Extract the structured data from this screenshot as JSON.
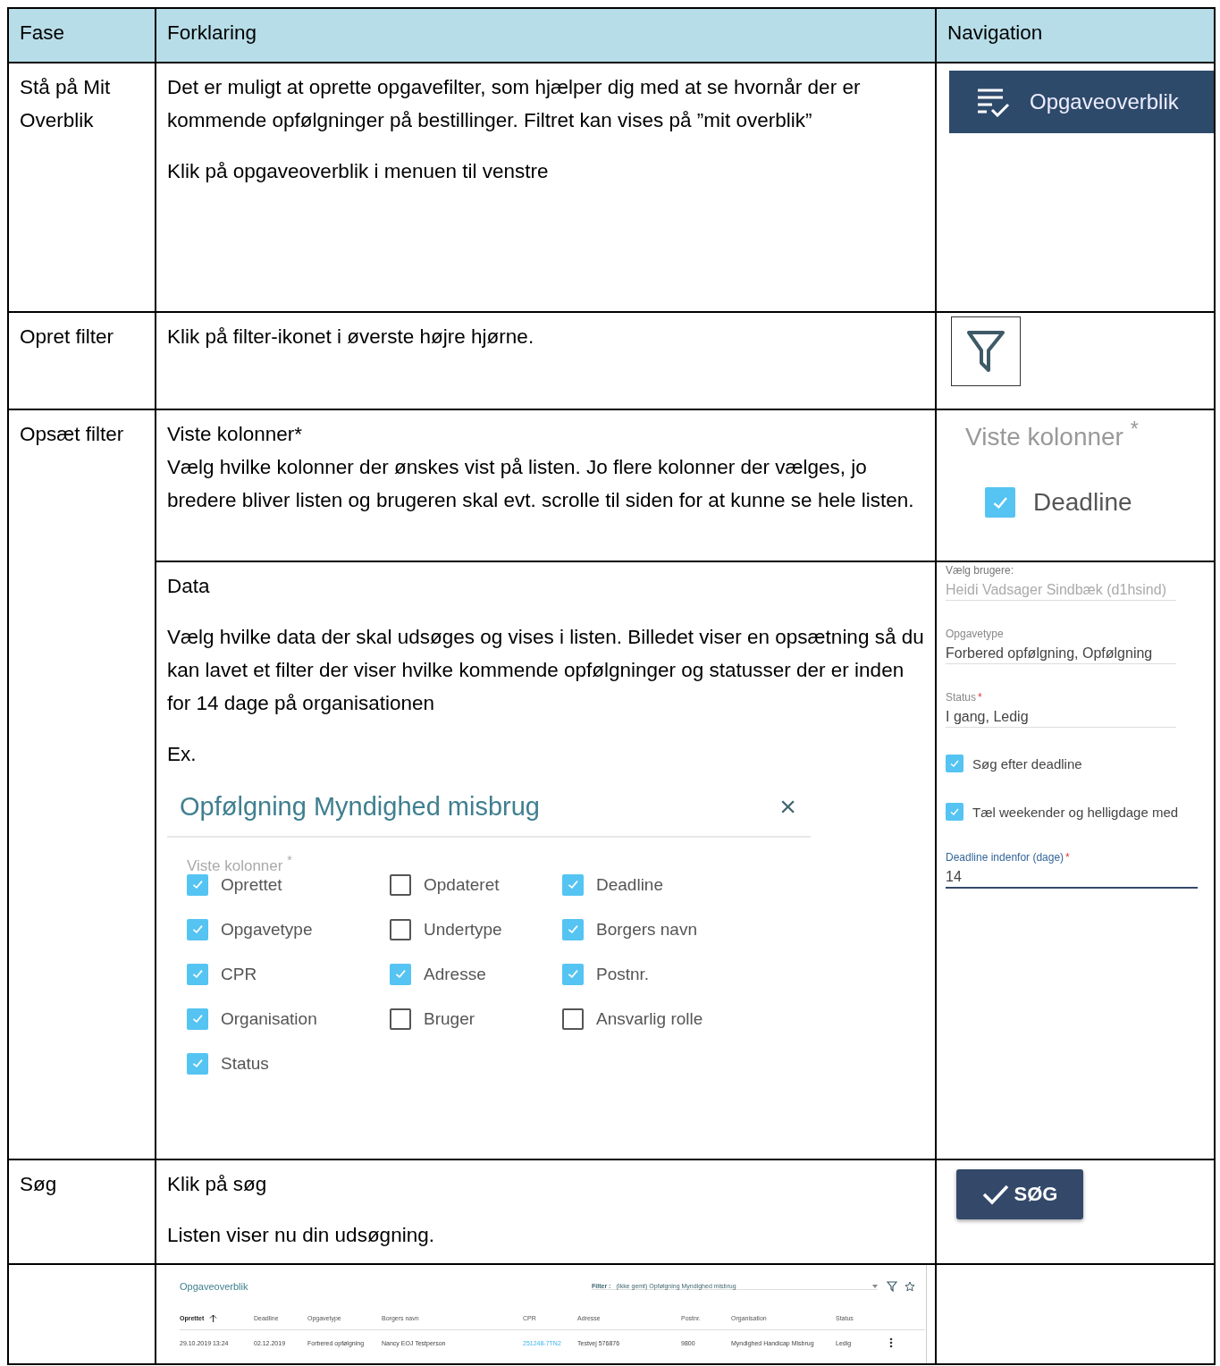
{
  "columns": [
    "Fase",
    "Forklaring",
    "Navigation"
  ],
  "rows": [
    {
      "phase": "Stå på Mit Overblik",
      "steps": [
        {
          "paragraphs": [
            "Det er muligt at oprette opgavefilter, som hjælper dig med at se hvornår der er kommende opfølgninger på bestillinger. Filtret kan vises på ”mit overblik”",
            "Klik på opgaveoverblik i menuen til venstre"
          ],
          "nav": {
            "kind": "menu_item",
            "label": "Opgaveoverblik"
          }
        }
      ]
    },
    {
      "phase": "Opret filter",
      "steps": [
        {
          "paragraphs": [
            "Klik på filter-ikonet i øverste højre hjørne."
          ],
          "nav": {
            "kind": "filter_icon"
          }
        }
      ]
    },
    {
      "phase": "Opsæt filter",
      "steps": [
        {
          "paragraphs": [
            "Viste kolonner*\nVælg hvilke kolonner der ønskes vist på listen. Jo flere kolonner der vælges, jo bredere bliver listen og brugeren skal evt. scrolle til siden for at kunne se hele listen."
          ],
          "nav": {
            "kind": "column_choice",
            "label": "Viste kolonner",
            "required_mark": "*",
            "option": {
              "label": "Deadline",
              "checked": true
            }
          }
        },
        {
          "paragraphs": [
            "Data",
            "Vælg hvilke data der skal udsøges og vises i listen. Billedet viser en opsætning så du kan lavet et filter der viser hvilke kommende opfølgninger og statusser der er inden for 14 dage på organisationen",
            "Ex."
          ],
          "dialog": {
            "title": "Opfølgning Myndighed misbrug",
            "close": "×",
            "label": "Viste kolonner",
            "required_mark": "*",
            "options": [
              {
                "label": "Oprettet",
                "checked": true
              },
              {
                "label": "Opdateret",
                "checked": false
              },
              {
                "label": "Deadline",
                "checked": true
              },
              {
                "label": "Opgavetype",
                "checked": true
              },
              {
                "label": "Undertype",
                "checked": false
              },
              {
                "label": "Borgers navn",
                "checked": true
              },
              {
                "label": "CPR",
                "checked": true
              },
              {
                "label": "Adresse",
                "checked": true
              },
              {
                "label": "Postnr.",
                "checked": true
              },
              {
                "label": "Organisation",
                "checked": true
              },
              {
                "label": "Bruger",
                "checked": false
              },
              {
                "label": "Ansvarlig rolle",
                "checked": false
              },
              {
                "label": "Status",
                "checked": true
              }
            ]
          },
          "nav": {
            "kind": "form",
            "items": [
              {
                "kind": "field",
                "label": "Vælg brugere:",
                "value": "Heidi Vadsager Sindbæk (d1hsind)",
                "disabled": true,
                "focused": false
              },
              {
                "kind": "field",
                "label": "Opgavetype",
                "value": "Forbered opfølgning, Opfølgning",
                "disabled": false,
                "focused": false
              },
              {
                "kind": "field",
                "label": "Status",
                "required_mark": "*",
                "value": "I gang, Ledig",
                "disabled": false,
                "focused": false
              },
              {
                "kind": "checkbox",
                "label": "Søg efter deadline",
                "checked": true
              },
              {
                "kind": "checkbox",
                "label": "Tæl weekender og helligdage med",
                "checked": true
              },
              {
                "kind": "field",
                "label": "Deadline indenfor (dage)",
                "required_mark": "*",
                "value": "14",
                "disabled": false,
                "focused": true
              }
            ]
          }
        }
      ]
    },
    {
      "phase": "Søg",
      "steps": [
        {
          "paragraphs": [
            "Klik på søg",
            "Listen viser nu din udsøgning."
          ],
          "nav": {
            "kind": "button",
            "label": "SØG"
          }
        }
      ]
    },
    {
      "steps": [
        {
          "overview": {
            "title": "Opgaveoverblik",
            "filter_label": "Filter :",
            "filter_value": "(Ikke gemt) Opfølgning Myndighed misbrug",
            "columns": [
              {
                "label": "Oprettet",
                "sorted": true
              },
              {
                "label": "Deadline",
                "sorted": false
              },
              {
                "label": "Opgavetype",
                "sorted": false
              },
              {
                "label": "Borgers navn",
                "sorted": false
              },
              {
                "label": "CPR",
                "sorted": false
              },
              {
                "label": "Adresse",
                "sorted": false
              },
              {
                "label": "Postnr.",
                "sorted": false
              },
              {
                "label": "Organisation",
                "sorted": false
              },
              {
                "label": "Status",
                "sorted": false
              }
            ],
            "rows": [
              {
                "cells": [
                  {
                    "text": "29.10.2019 13:24",
                    "kind": "text"
                  },
                  {
                    "text": "02.12.2019",
                    "kind": "text"
                  },
                  {
                    "text": "Forbered opfølgning",
                    "kind": "text"
                  },
                  {
                    "text": "Nancy EOJ Testperson",
                    "kind": "text"
                  },
                  {
                    "text": "251248-7TN2",
                    "kind": "link"
                  },
                  {
                    "text": "Testvej 576876",
                    "kind": "text"
                  },
                  {
                    "text": "9800",
                    "kind": "text"
                  },
                  {
                    "text": "Myndighed Handicap Misbrug",
                    "kind": "text"
                  },
                  {
                    "text": "Ledig",
                    "kind": "text"
                  }
                ]
              }
            ]
          }
        }
      ]
    }
  ]
}
